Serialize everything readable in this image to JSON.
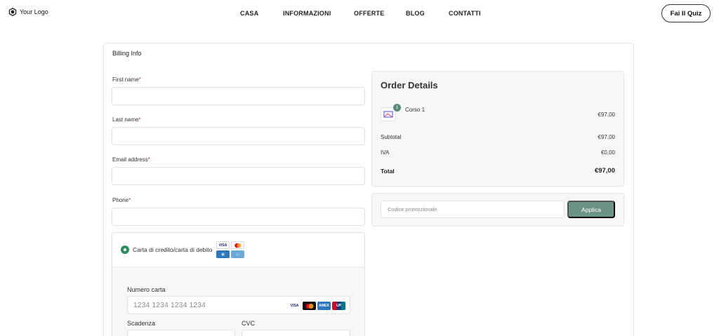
{
  "header": {
    "logo_text": "Your Logo",
    "nav": [
      {
        "label": "CASA"
      },
      {
        "label": "INFORMAZIONI"
      },
      {
        "label": "OFFERTE"
      },
      {
        "label": "BLOG"
      },
      {
        "label": "CONTATTI"
      }
    ],
    "cta_label": "Fai Il Quiz"
  },
  "billing": {
    "title": "Billing Info",
    "fields": [
      {
        "label": "First name",
        "required": "*",
        "value": ""
      },
      {
        "label": "Last name",
        "required": "*",
        "value": ""
      },
      {
        "label": "Email address",
        "required": "*",
        "value": ""
      },
      {
        "label": "Phone",
        "required": "*",
        "value": ""
      }
    ]
  },
  "payment": {
    "method_label": "Carta di credito/carta di debito",
    "card_number_label": "Numero carta",
    "card_number_placeholder": "1234 1234 1234 1234",
    "expiry_label": "Scadenza",
    "cvc_label": "CVC",
    "brands": [
      "VISA",
      "MC",
      "AMEX",
      "UP"
    ]
  },
  "order": {
    "title": "Order Details",
    "item": {
      "name": "Corso 1",
      "qty": "1",
      "price": "€97,00"
    },
    "subtotal_label": "Subtotal",
    "subtotal_value": "€97,00",
    "tax_label": "IVA",
    "tax_value": "€0,00",
    "total_label": "Total",
    "total_value": "€97,00"
  },
  "promo": {
    "placeholder": "Codice promozionale",
    "button_label": "Applica"
  },
  "colors": {
    "accent": "#6b9484",
    "radio": "#2e8b5a",
    "badge": "#5b8a78"
  }
}
